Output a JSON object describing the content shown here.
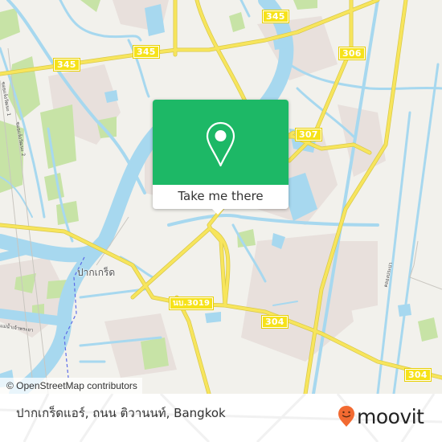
{
  "map": {
    "route_shields": [
      {
        "id": "r345a",
        "label": "345"
      },
      {
        "id": "r345b",
        "label": "345"
      },
      {
        "id": "r345c",
        "label": "345"
      },
      {
        "id": "r306",
        "label": "306"
      },
      {
        "id": "r307",
        "label": "307"
      },
      {
        "id": "r3019",
        "label": "นบ.3019"
      },
      {
        "id": "r304a",
        "label": "304"
      },
      {
        "id": "r304b",
        "label": "304"
      }
    ],
    "place_labels": [
      {
        "id": "pakkret",
        "label": "ปากเกร็ด"
      }
    ],
    "road_labels": [
      {
        "id": "soi1",
        "label": "ซอยแจ้งวัฒนะ 1"
      },
      {
        "id": "soi2",
        "label": "ซอยแจ้งวัฒนะ 2"
      },
      {
        "id": "chaophraya",
        "label": "แม่น้ำเจ้าพระยา"
      },
      {
        "id": "canal",
        "label": "คลองประปา"
      }
    ],
    "colors": {
      "land": "#f2f1ec",
      "water": "#a7d8ef",
      "park": "#c7e3a6",
      "urban": "#e8e0dc",
      "road": "#f7e55c",
      "shield": "#f6e21a"
    }
  },
  "popup": {
    "icon": "location-pin-icon",
    "button_label": "Take me there",
    "color": "#1db866"
  },
  "attribution": "© OpenStreetMap contributors",
  "footer": {
    "address": "ปากเกร็ดแอร์, ถนน ติวานนท์, Bangkok",
    "brand": "moovit",
    "brand_color": "#f26a31"
  }
}
